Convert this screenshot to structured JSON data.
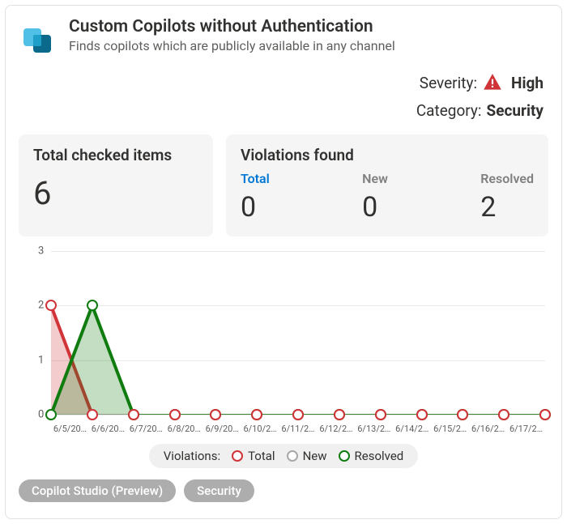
{
  "header": {
    "title": "Custom Copilots without Authentication",
    "subtitle": "Finds copilots which are publicly available in any channel"
  },
  "meta": {
    "severity_label": "Severity:",
    "severity_value": "High",
    "category_label": "Category:",
    "category_value": "Security"
  },
  "stats": {
    "checked_title": "Total checked items",
    "checked_value": "6",
    "violations_title": "Violations found",
    "cols": {
      "total": {
        "label": "Total",
        "value": "0"
      },
      "new": {
        "label": "New",
        "value": "0"
      },
      "resolved": {
        "label": "Resolved",
        "value": "2"
      }
    }
  },
  "legend": {
    "title": "Violations:",
    "total": "Total",
    "new": "New",
    "resolved": "Resolved"
  },
  "tags": [
    "Copilot Studio (Preview)",
    "Security"
  ],
  "chart_data": {
    "type": "line",
    "categories": [
      "6/5/20…",
      "6/6/20…",
      "6/7/20…",
      "6/8/20…",
      "6/9/20…",
      "6/10/2…",
      "6/11/2…",
      "6/12/2…",
      "6/13/2…",
      "6/14/2…",
      "6/15/2…",
      "6/16/2…",
      "6/17/2…"
    ],
    "series": [
      {
        "name": "Total",
        "color": "#d13438",
        "values": [
          2,
          0,
          0,
          0,
          0,
          0,
          0,
          0,
          0,
          0,
          0,
          0,
          0
        ]
      },
      {
        "name": "New",
        "color": "#a8a8a8",
        "values": [
          0,
          0,
          0,
          0,
          0,
          0,
          0,
          0,
          0,
          0,
          0,
          0,
          0
        ]
      },
      {
        "name": "Resolved",
        "color": "#107c10",
        "values": [
          0,
          2,
          0,
          0,
          0,
          0,
          0,
          0,
          0,
          0,
          0,
          0,
          0
        ]
      }
    ],
    "ylim": [
      0,
      3
    ],
    "yticks": [
      0,
      1,
      2,
      3
    ],
    "xlabel": "",
    "ylabel": ""
  }
}
